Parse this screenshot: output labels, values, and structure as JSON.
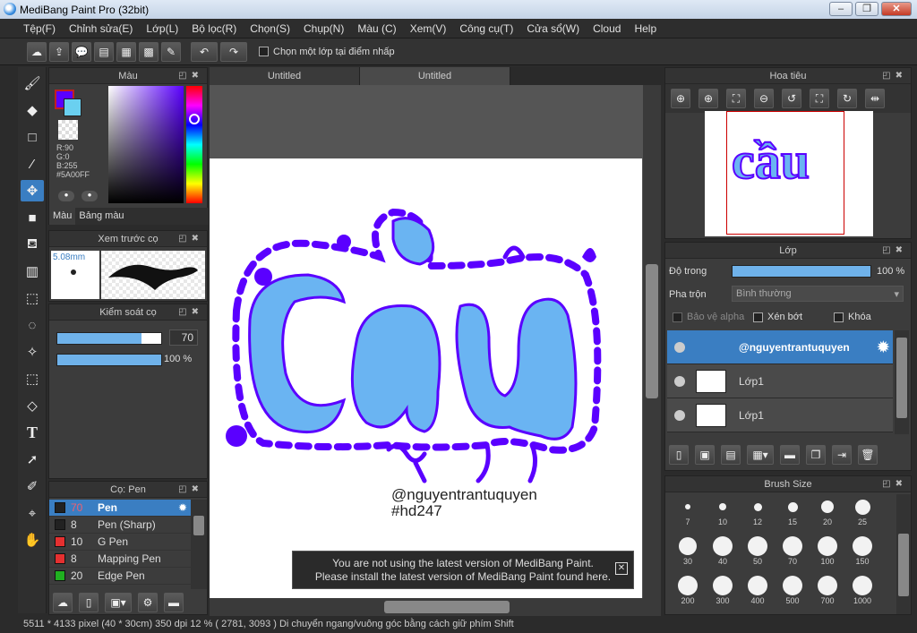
{
  "window": {
    "title": "MediBang Paint Pro (32bit)"
  },
  "menu": [
    "Tệp(F)",
    "Chỉnh sửa(E)",
    "Lớp(L)",
    "Bộ lọc(R)",
    "Chọn(S)",
    "Chụp(N)",
    "Màu (C)",
    "Xem(V)",
    "Công cụ(T)",
    "Cửa sổ(W)",
    "Cloud",
    "Help"
  ],
  "toolbar": {
    "checkbox_label": "Chọn một lớp tại điểm nhấp"
  },
  "color_panel": {
    "title": "Màu",
    "r": "R:90",
    "g": "G:0",
    "b": "B:255",
    "hex": "#5A00FF",
    "tab_color": "Màu",
    "tab_palette": "Bảng màu",
    "primary": "#5a00ff",
    "secondary": "#6ad0f0"
  },
  "brush_preview": {
    "title": "Xem trước cọ",
    "size": "5.08mm"
  },
  "brush_control": {
    "title": "Kiểm soát cọ",
    "size_value": "70",
    "opacity_value": "100 %",
    "size_fraction": 0.81,
    "opacity_fraction": 1.0
  },
  "brush_list": {
    "title": "Cọ: Pen",
    "items": [
      {
        "size": "70",
        "name": "Pen",
        "color": "#222222",
        "selected": true
      },
      {
        "size": "8",
        "name": "Pen (Sharp)",
        "color": "#222222",
        "selected": false
      },
      {
        "size": "10",
        "name": "G Pen",
        "color": "#e53030",
        "selected": false
      },
      {
        "size": "8",
        "name": "Mapping Pen",
        "color": "#e53030",
        "selected": false
      },
      {
        "size": "20",
        "name": "Edge Pen",
        "color": "#20b020",
        "selected": false
      }
    ]
  },
  "tabs": [
    "Untitled",
    "Untitled"
  ],
  "canvas": {
    "word": "cầu",
    "credit": "@nguyentrantuquyen",
    "hashtag": "#hd247",
    "fill": "#6ab4f2",
    "outline": "#5a00ff"
  },
  "notice": {
    "line1": "You are not using the latest version of MediBang Paint.",
    "line2": "Please install the latest version of MediBang Paint found here.",
    "close": "✕"
  },
  "navigator": {
    "title": "Hoa tiêu"
  },
  "layers": {
    "title": "Lớp",
    "opacity_label": "Độ trong",
    "opacity_value": "100 %",
    "opacity_fraction": 1.0,
    "blend_label": "Pha trộn",
    "blend_value": "Bình thường",
    "protect_alpha": "Bảo vệ alpha",
    "clipping": "Xén bớt",
    "lock": "Khóa",
    "items": [
      {
        "name": "@nguyentrantuquyen",
        "selected": true
      },
      {
        "name": "Lớp1",
        "selected": false
      },
      {
        "name": "Lớp1",
        "selected": false
      }
    ]
  },
  "brush_size": {
    "title": "Brush Size",
    "sizes": [
      "7",
      "10",
      "12",
      "15",
      "20",
      "25",
      "30",
      "40",
      "50",
      "70",
      "100",
      "150",
      "200",
      "300",
      "400",
      "500",
      "700",
      "1000"
    ]
  },
  "status": {
    "text": "5511 * 4133 pixel   (40 * 30cm)  350 dpi   12 %   ( 2781, 3093 )   Di chuyển ngang/vuông góc bằng cách giữ phím Shift"
  }
}
